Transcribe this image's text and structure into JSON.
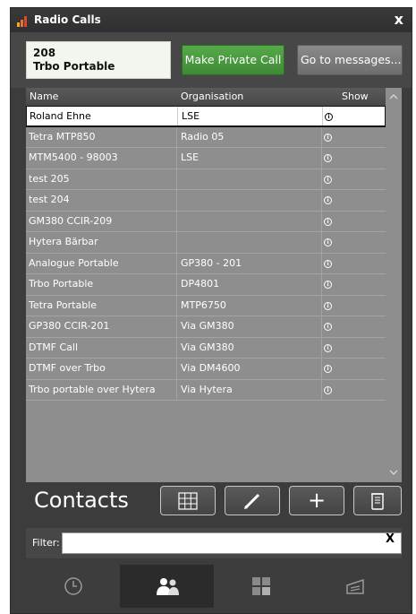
{
  "window": {
    "title": "Radio Calls",
    "close_label": "x"
  },
  "caller": {
    "id": "208",
    "name": "Trbo Portable"
  },
  "buttons": {
    "private_call": "Make Private Call",
    "messages": "Go to messages..."
  },
  "list": {
    "columns": [
      "Name",
      "Organisation",
      "Show"
    ],
    "rows": [
      {
        "name": "Roland Ehne",
        "org": "LSE",
        "selected": true
      },
      {
        "name": "Tetra MTP850",
        "org": "Radio 05"
      },
      {
        "name": "MTM5400 - 98003",
        "org": "LSE"
      },
      {
        "name": "test 205",
        "org": ""
      },
      {
        "name": "test 204",
        "org": ""
      },
      {
        "name": "GM380 CCIR-209",
        "org": ""
      },
      {
        "name": "Hytera Bärbar",
        "org": ""
      },
      {
        "name": "Analogue Portable",
        "org": "GP380 - 201"
      },
      {
        "name": "Trbo Portable",
        "org": "DP4801"
      },
      {
        "name": "Tetra Portable",
        "org": "MTP6750"
      },
      {
        "name": "GP380 CCIR-201",
        "org": "Via GM380"
      },
      {
        "name": "DTMF Call",
        "org": "Via GM380"
      },
      {
        "name": "DTMF over Trbo",
        "org": "Via DM4600"
      },
      {
        "name": "Trbo portable over Hytera",
        "org": "Via Hytera"
      }
    ],
    "show_icon": "info-icon"
  },
  "contacts": {
    "label": "Contacts",
    "tools": [
      "grid-icon",
      "pencil-icon",
      "plus-icon",
      "trash-icon"
    ],
    "plus_label": "+"
  },
  "filter": {
    "label": "Filter:",
    "value": "",
    "clear_label": "X"
  },
  "tabs": [
    "clock-icon",
    "people-icon",
    "keypad-icon",
    "messages-icon"
  ],
  "colors": {
    "accent_green": "#4a9b40",
    "title_icon": [
      "#f5a623",
      "#e8732c",
      "#d94a2b"
    ]
  }
}
